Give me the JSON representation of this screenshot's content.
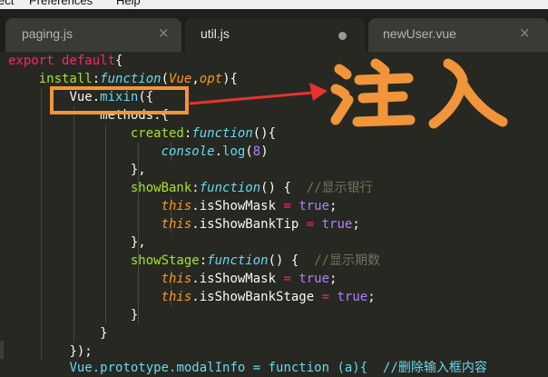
{
  "menu": [
    "ect",
    "Preferences",
    "Help"
  ],
  "tabs": [
    {
      "label": "paging.js",
      "close": "×"
    },
    {
      "label": "util.js",
      "modified": true
    },
    {
      "label": "newUser.vue",
      "close": "×"
    }
  ],
  "annotation_text": "注入",
  "colors": {
    "editor_bg": "#272822",
    "keyword": "#f92672",
    "function_name": "#a6e22e",
    "storage": "#66d9ef",
    "number": "#ae81ff",
    "parameter": "#fd971f",
    "comment": "#75715e",
    "annotation": "#f0953a",
    "arrow": "#e8322e"
  },
  "code": {
    "l1_export": "export",
    "l1_default": "default",
    "l1_brace": "{",
    "l2_install": "install",
    "l2_colon": ":",
    "l2_function": "function",
    "l2_paren_open": "(",
    "l2_vue": "Vue",
    "l2_comma": ",",
    "l2_opt": "opt",
    "l2_tail": "){",
    "l3_vue": "Vue.",
    "l3_mixin": "mixin",
    "l3_tail": "({",
    "l4_methods": "methods:{",
    "l5_created": "created",
    "l5_colon": ":",
    "l5_function": "function",
    "l5_tail": "(){",
    "l6_console": "console",
    "l6_dot": ".",
    "l6_log": "log",
    "l6_open": "(",
    "l6_num": "8",
    "l6_close": ")",
    "l7_close": "},",
    "l8_showbank": "showBank",
    "l8_colon": ":",
    "l8_function": "function",
    "l8_tail": "() {",
    "l8_comment": "//显示银行",
    "l9_this": "this",
    "l9_prop": ".isShowMask",
    "l9_eq": "=",
    "l9_true": "true",
    "l9_semi": ";",
    "l10_this": "this",
    "l10_prop": ".isShowBankTip",
    "l10_eq": "=",
    "l10_true": "true",
    "l10_semi": ";",
    "l11_close": "},",
    "l12_showstage": "showStage",
    "l12_colon": ":",
    "l12_function": "function",
    "l12_tail": "() {",
    "l12_comment": "//显示期数",
    "l13_this": "this",
    "l13_prop": ".isShowMask",
    "l13_eq": "=",
    "l13_true": "true",
    "l13_semi": ";",
    "l14_this": "this",
    "l14_prop": ".isShowBankStage",
    "l14_eq": "=",
    "l14_true": "true",
    "l14_semi": ";",
    "l15_close": "}",
    "l16_close": "}",
    "l17_close": "});",
    "l18_partial": "Vue.prototype.modalInfo = function (a){  //删除输入框内容"
  }
}
